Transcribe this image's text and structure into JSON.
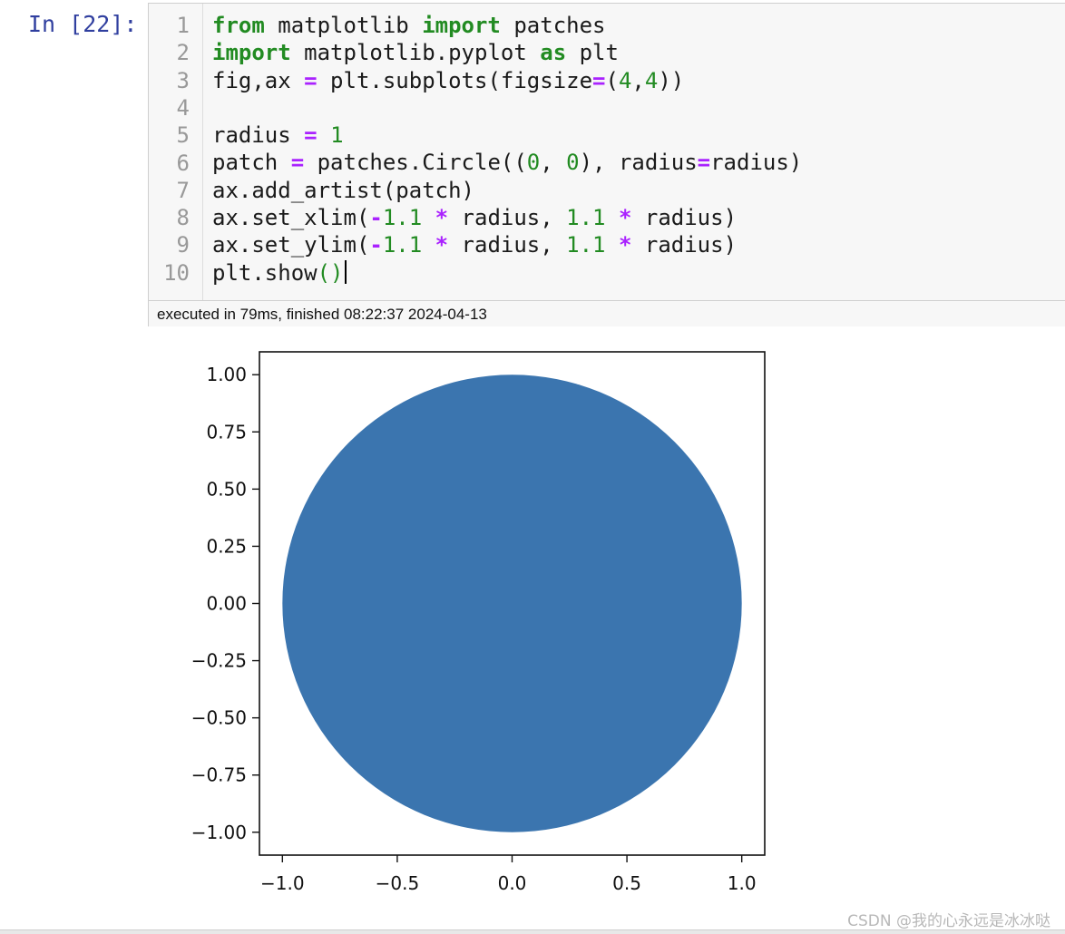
{
  "cell": {
    "prompt": "In [22]:",
    "lines": [
      [
        [
          "kw",
          "from"
        ],
        [
          "t",
          " matplotlib "
        ],
        [
          "kw",
          "import"
        ],
        [
          "t",
          " patches"
        ]
      ],
      [
        [
          "kw",
          "import"
        ],
        [
          "t",
          " matplotlib.pyplot "
        ],
        [
          "kw",
          "as"
        ],
        [
          "t",
          " plt"
        ]
      ],
      [
        [
          "t",
          "fig,ax "
        ],
        [
          "op",
          "="
        ],
        [
          "t",
          " plt.subplots(figsize"
        ],
        [
          "op",
          "="
        ],
        [
          "t",
          "("
        ],
        [
          "num",
          "4"
        ],
        [
          "t",
          ","
        ],
        [
          "num",
          "4"
        ],
        [
          "t",
          "))"
        ]
      ],
      [],
      [
        [
          "t",
          "radius "
        ],
        [
          "op",
          "="
        ],
        [
          "t",
          " "
        ],
        [
          "num",
          "1"
        ]
      ],
      [
        [
          "t",
          "patch "
        ],
        [
          "op",
          "="
        ],
        [
          "t",
          " patches.Circle(("
        ],
        [
          "num",
          "0"
        ],
        [
          "t",
          ", "
        ],
        [
          "num",
          "0"
        ],
        [
          "t",
          "), radius"
        ],
        [
          "op",
          "="
        ],
        [
          "t",
          "radius)"
        ]
      ],
      [
        [
          "t",
          "ax.add_artist(patch)"
        ]
      ],
      [
        [
          "t",
          "ax.set_xlim("
        ],
        [
          "op",
          "-"
        ],
        [
          "num",
          "1.1"
        ],
        [
          "t",
          " "
        ],
        [
          "op",
          "*"
        ],
        [
          "t",
          " radius, "
        ],
        [
          "num",
          "1.1"
        ],
        [
          "t",
          " "
        ],
        [
          "op",
          "*"
        ],
        [
          "t",
          " radius)"
        ]
      ],
      [
        [
          "t",
          "ax.set_ylim("
        ],
        [
          "op",
          "-"
        ],
        [
          "num",
          "1.1"
        ],
        [
          "t",
          " "
        ],
        [
          "op",
          "*"
        ],
        [
          "t",
          " radius, "
        ],
        [
          "num",
          "1.1"
        ],
        [
          "t",
          " "
        ],
        [
          "op",
          "*"
        ],
        [
          "t",
          " radius)"
        ]
      ],
      [
        [
          "t",
          "plt.show"
        ],
        [
          "br",
          "()"
        ],
        [
          "cursor",
          ""
        ]
      ]
    ],
    "status": "executed in 79ms, finished 08:22:37 2024-04-13"
  },
  "chart_data": {
    "type": "scatter",
    "shape": "circle",
    "center": [
      0,
      0
    ],
    "radius": 1,
    "fill_color": "#3b75af",
    "xlim": [
      -1.1,
      1.1
    ],
    "ylim": [
      -1.1,
      1.1
    ],
    "xticks": [
      "−1.0",
      "−0.5",
      "0.0",
      "0.5",
      "1.0"
    ],
    "xtick_values": [
      -1.0,
      -0.5,
      0.0,
      0.5,
      1.0
    ],
    "yticks": [
      "1.00",
      "0.75",
      "0.50",
      "0.25",
      "0.00",
      "−0.25",
      "−0.50",
      "−0.75",
      "−1.00"
    ],
    "ytick_values": [
      1.0,
      0.75,
      0.5,
      0.25,
      0.0,
      -0.25,
      -0.5,
      -0.75,
      -1.0
    ],
    "grid": false
  },
  "watermark": "CSDN @我的心永远是冰冰哒"
}
